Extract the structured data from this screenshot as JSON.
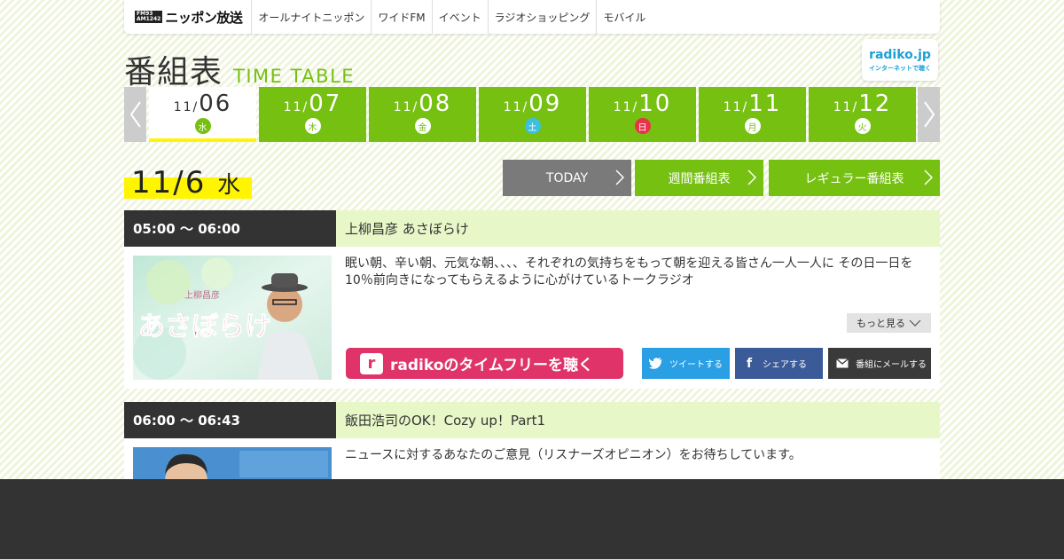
{
  "nav": {
    "logo_badge_top": "FM93",
    "logo_badge_bottom": "AM1242",
    "logo_text": "ニッポン放送",
    "items": [
      {
        "label": "オールナイトニッポン"
      },
      {
        "label": "ワイドFM"
      },
      {
        "label": "イベント"
      },
      {
        "label": "ラジオショッピング"
      },
      {
        "label": "モバイル"
      }
    ]
  },
  "title": {
    "jp": "番組表",
    "en": "TIME TABLE"
  },
  "radiko_badge": {
    "name": "radiko.jp",
    "tagline": "インターネットで聴く"
  },
  "days": [
    {
      "month": "11/",
      "day": "06",
      "dow": "水",
      "type": "weekday",
      "active": true
    },
    {
      "month": "11/",
      "day": "07",
      "dow": "木",
      "type": "weekday"
    },
    {
      "month": "11/",
      "day": "08",
      "dow": "金",
      "type": "weekday"
    },
    {
      "month": "11/",
      "day": "09",
      "dow": "土",
      "type": "sat"
    },
    {
      "month": "11/",
      "day": "10",
      "dow": "日",
      "type": "sun"
    },
    {
      "month": "11/",
      "day": "11",
      "dow": "月",
      "type": "weekday"
    },
    {
      "month": "11/",
      "day": "12",
      "dow": "火",
      "type": "weekday"
    }
  ],
  "current_date": {
    "date": "11/6",
    "dow": "水"
  },
  "buttons": {
    "today": "TODAY",
    "weekly": "週間番組表",
    "regular": "レギュラー番組表"
  },
  "programs": [
    {
      "time": "05:00 ～ 06:00",
      "title": "上柳昌彦 あさぼらけ",
      "thumb_text_small": "上柳昌彦",
      "thumb_text": "あさぼらけ",
      "description": "眠い朝、辛い朝、元気な朝、、、、それぞれの気持ちをもって朝を迎える皆さん一人一人に その日一日を10％前向きになってもらえるように心がけているトークラジオ",
      "more": "もっと見る",
      "radiko_label": "radikoのタイムフリーを聴く",
      "tweet": "ツイートする",
      "share": "シェアする",
      "mail": "番組にメールする"
    },
    {
      "time": "06:00 ～ 06:43",
      "title": "飯田浩司のOK！Cozy up！Part1",
      "description": "ニュースに対するあなたのご意見（リスナーズオピニオン）をお待ちしています。"
    }
  ],
  "colors": {
    "accent_green": "#76c012",
    "highlight_yellow": "#fff500",
    "radiko_pink": "#e0336a",
    "twitter": "#2a9fe3",
    "facebook": "#3b5a98"
  }
}
